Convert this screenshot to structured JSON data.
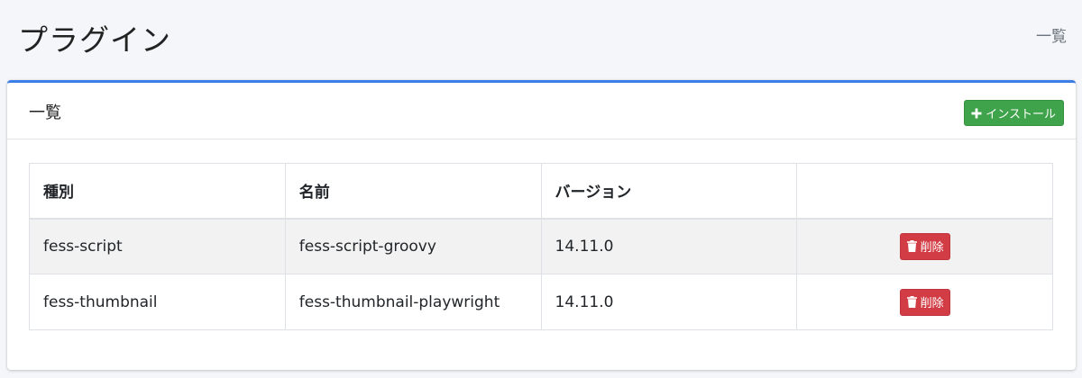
{
  "header": {
    "title": "プラグイン",
    "breadcrumb": "一覧"
  },
  "card": {
    "title": "一覧",
    "install_label": "インストール"
  },
  "table": {
    "columns": [
      "種別",
      "名前",
      "バージョン",
      ""
    ],
    "rows": [
      {
        "type": "fess-script",
        "name": "fess-script-groovy",
        "version": "14.11.0",
        "action_label": "削除"
      },
      {
        "type": "fess-thumbnail",
        "name": "fess-thumbnail-playwright",
        "version": "14.11.0",
        "action_label": "削除"
      }
    ]
  },
  "colors": {
    "accent": "#3c7ee8",
    "install_button": "#3fa34b",
    "delete_button": "#d23d45"
  },
  "icons": {
    "install": "plus-icon",
    "delete": "trash-icon"
  }
}
